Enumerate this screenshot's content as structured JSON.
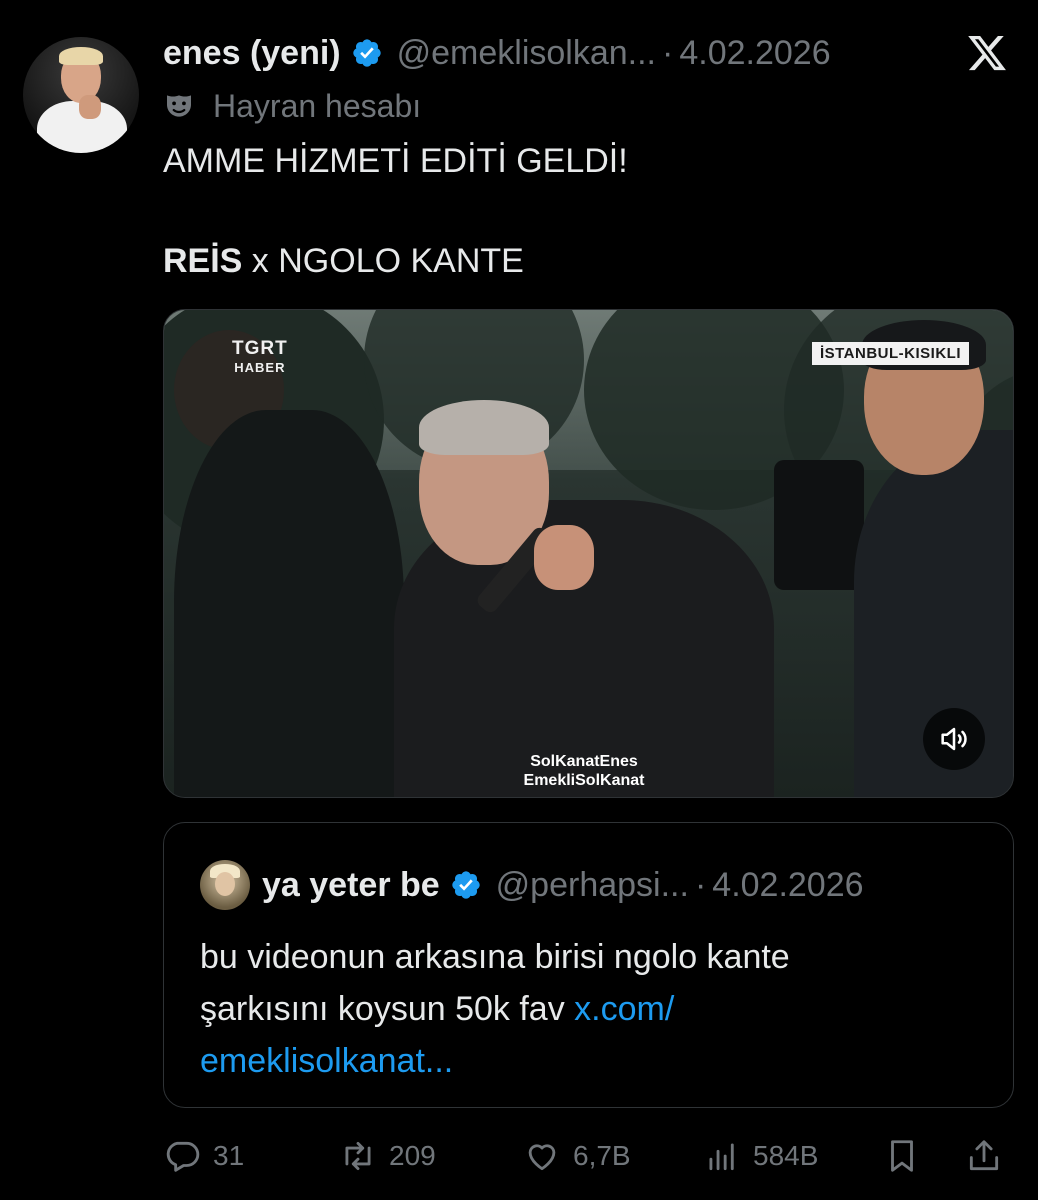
{
  "tweet": {
    "display_name": "enes (yeni)",
    "handle": "@emeklisolkan...",
    "separator": "·",
    "date": "4.02.2026",
    "account_label": "Hayran hesabı",
    "text_line1": "AMME HİZMETİ EDİTİ GELDİ!",
    "text_line2_bold": "REİS",
    "text_line2_rest": " x NGOLO KANTE"
  },
  "media": {
    "channel_name": "TGRT",
    "channel_sub": "HABER",
    "location_badge": "İSTANBUL-KISIKLI",
    "watermark_line1": "SolKanatEnes",
    "watermark_line2": "EmekliSolKanat"
  },
  "quote": {
    "display_name": "ya yeter be",
    "handle": "@perhapsi...",
    "separator": "·",
    "date": "4.02.2026",
    "text_line1": "bu videonun arkasına birisi ngolo kante",
    "text_line2": "şarkısını koysun 50k fav ",
    "link_part1": "x.com/",
    "link_part2": "emeklisolkanat..."
  },
  "actions": {
    "replies": "31",
    "reposts": "209",
    "likes": "6,7B",
    "views": "584B"
  },
  "colors": {
    "background": "#000000",
    "text_primary": "#e7e9ea",
    "text_secondary": "#71767b",
    "link": "#1d9bf0",
    "verified": "#1d9bf0",
    "border": "#2f3336"
  }
}
